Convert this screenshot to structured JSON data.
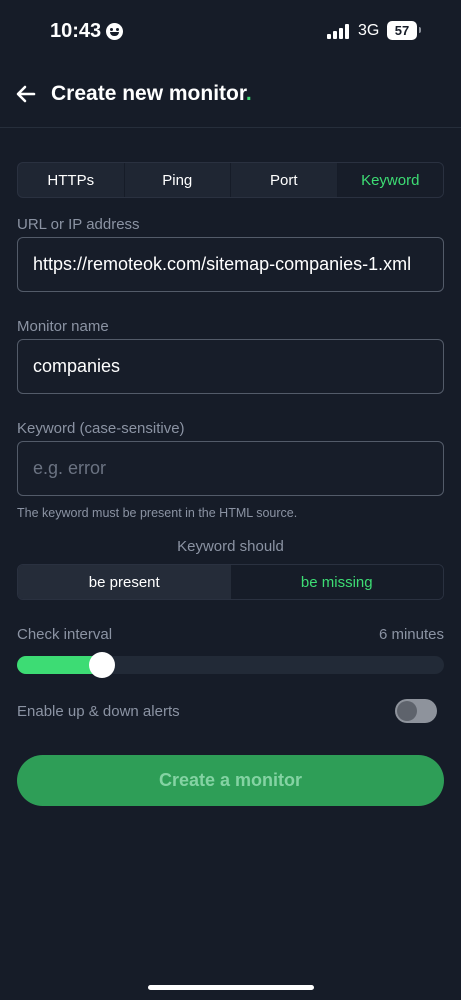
{
  "status_bar": {
    "time": "10:43",
    "network": "3G",
    "battery": "57"
  },
  "header": {
    "title": "Create new monitor",
    "title_dot": "."
  },
  "tabs": [
    {
      "label": "HTTPs",
      "active": false
    },
    {
      "label": "Ping",
      "active": false
    },
    {
      "label": "Port",
      "active": false
    },
    {
      "label": "Keyword",
      "active": true
    }
  ],
  "url_field": {
    "label": "URL or IP address",
    "value": "https://remoteok.com/sitemap-companies-1.xml"
  },
  "name_field": {
    "label": "Monitor name",
    "value": "companies"
  },
  "keyword_field": {
    "label": "Keyword (case-sensitive)",
    "placeholder": "e.g. error",
    "helper": "The keyword must be present in the HTML source."
  },
  "keyword_should": {
    "label": "Keyword should",
    "options": [
      "be present",
      "be missing"
    ]
  },
  "check_interval": {
    "label": "Check interval",
    "value": "6 minutes",
    "slider_fraction": 0.2
  },
  "alerts": {
    "label": "Enable up & down alerts",
    "enabled": false
  },
  "submit": {
    "label": "Create a monitor"
  },
  "colors": {
    "accent": "#3ddc74",
    "background": "#161c28",
    "button": "#2e9e57"
  }
}
